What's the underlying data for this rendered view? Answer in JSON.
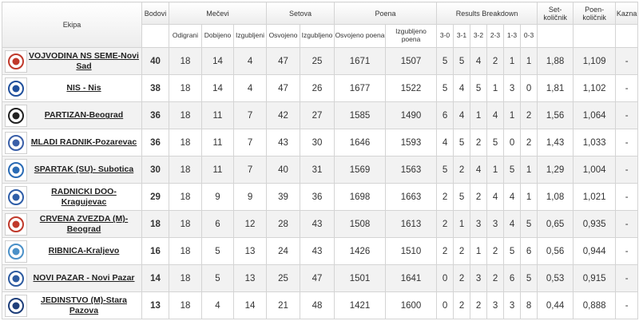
{
  "headers": {
    "team": "Ekipa",
    "points": "Bodovi",
    "matches": "Mečevi",
    "sets": "Setova",
    "points_scored": "Poena",
    "results": "Results Breakdown",
    "set_ratio": "Set-količnik",
    "point_ratio": "Poen-količnik",
    "penalty": "Kazna",
    "played": "Odigrani",
    "won": "Dobijeno",
    "lost": "Izgubljeni",
    "sets_won": "Osvojeno",
    "sets_lost": "Izgubljeno",
    "pts_won": "Osvojeno poena",
    "pts_lost": "Izgubljeno poena",
    "r30": "3-0",
    "r31": "3-1",
    "r32": "3-2",
    "r23": "2-3",
    "r13": "1-3",
    "r03": "0-3"
  },
  "rows": [
    {
      "team": "VOJVODINA NS SEME-Novi Sad",
      "points": "40",
      "played": "18",
      "won": "14",
      "lost": "4",
      "sw": "47",
      "sl": "25",
      "pw": "1671",
      "pl": "1507",
      "r30": "5",
      "r31": "5",
      "r32": "4",
      "r23": "2",
      "r13": "1",
      "r03": "1",
      "sr": "1,88",
      "pr": "1,109",
      "pen": "-",
      "logo": "vojvodina-logo",
      "color": "#c0392b"
    },
    {
      "team": "NIS - Nis",
      "points": "38",
      "played": "18",
      "won": "14",
      "lost": "4",
      "sw": "47",
      "sl": "26",
      "pw": "1677",
      "pl": "1522",
      "r30": "5",
      "r31": "4",
      "r32": "5",
      "r23": "1",
      "r13": "3",
      "r03": "0",
      "sr": "1,81",
      "pr": "1,102",
      "pen": "-",
      "logo": "nis-logo",
      "color": "#1f4f9c"
    },
    {
      "team": "PARTIZAN-Beograd",
      "points": "36",
      "played": "18",
      "won": "11",
      "lost": "7",
      "sw": "42",
      "sl": "27",
      "pw": "1585",
      "pl": "1490",
      "r30": "6",
      "r31": "4",
      "r32": "1",
      "r23": "4",
      "r13": "1",
      "r03": "2",
      "sr": "1,56",
      "pr": "1,064",
      "pen": "-",
      "logo": "partizan-logo",
      "color": "#222222"
    },
    {
      "team": "MLADI RADNIK-Pozarevac",
      "points": "36",
      "played": "18",
      "won": "11",
      "lost": "7",
      "sw": "43",
      "sl": "30",
      "pw": "1646",
      "pl": "1593",
      "r30": "4",
      "r31": "5",
      "r32": "2",
      "r23": "5",
      "r13": "0",
      "r03": "2",
      "sr": "1,43",
      "pr": "1,033",
      "pen": "-",
      "logo": "mladi-radnik-logo",
      "color": "#3a5fa8"
    },
    {
      "team": "SPARTAK (SU)- Subotica",
      "points": "30",
      "played": "18",
      "won": "11",
      "lost": "7",
      "sw": "40",
      "sl": "31",
      "pw": "1569",
      "pl": "1563",
      "r30": "5",
      "r31": "2",
      "r32": "4",
      "r23": "1",
      "r13": "5",
      "r03": "1",
      "sr": "1,29",
      "pr": "1,004",
      "pen": "-",
      "logo": "spartak-logo",
      "color": "#2a6bb5"
    },
    {
      "team": "RADNICKI DOO-Kragujevac",
      "points": "29",
      "played": "18",
      "won": "9",
      "lost": "9",
      "sw": "39",
      "sl": "36",
      "pw": "1698",
      "pl": "1663",
      "r30": "2",
      "r31": "5",
      "r32": "2",
      "r23": "4",
      "r13": "4",
      "r03": "1",
      "sr": "1,08",
      "pr": "1,021",
      "pen": "-",
      "logo": "radnicki-logo",
      "color": "#2f5ea8"
    },
    {
      "team": "CRVENA ZVEZDA (M)-Beograd",
      "points": "18",
      "played": "18",
      "won": "6",
      "lost": "12",
      "sw": "28",
      "sl": "43",
      "pw": "1508",
      "pl": "1613",
      "r30": "2",
      "r31": "1",
      "r32": "3",
      "r23": "3",
      "r13": "4",
      "r03": "5",
      "sr": "0,65",
      "pr": "0,935",
      "pen": "-",
      "logo": "crvena-zvezda-logo",
      "color": "#c0392b"
    },
    {
      "team": "RIBNICA-Kraljevo",
      "points": "16",
      "played": "18",
      "won": "5",
      "lost": "13",
      "sw": "24",
      "sl": "43",
      "pw": "1426",
      "pl": "1510",
      "r30": "2",
      "r31": "2",
      "r32": "1",
      "r23": "2",
      "r13": "5",
      "r03": "6",
      "sr": "0,56",
      "pr": "0,944",
      "pen": "-",
      "logo": "ribnica-logo",
      "color": "#4a90c8"
    },
    {
      "team": "NOVI PAZAR - Novi Pazar",
      "points": "14",
      "played": "18",
      "won": "5",
      "lost": "13",
      "sw": "25",
      "sl": "47",
      "pw": "1501",
      "pl": "1641",
      "r30": "0",
      "r31": "2",
      "r32": "3",
      "r23": "2",
      "r13": "6",
      "r03": "5",
      "sr": "0,53",
      "pr": "0,915",
      "pen": "-",
      "logo": "novi-pazar-logo",
      "color": "#2c5aa0"
    },
    {
      "team": "JEDINSTVO (M)-Stara Pazova",
      "points": "13",
      "played": "18",
      "won": "4",
      "lost": "14",
      "sw": "21",
      "sl": "48",
      "pw": "1421",
      "pl": "1600",
      "r30": "0",
      "r31": "2",
      "r32": "2",
      "r23": "3",
      "r13": "3",
      "r03": "8",
      "sr": "0,44",
      "pr": "0,888",
      "pen": "-",
      "logo": "jedinstvo-logo",
      "color": "#1f3f7a"
    }
  ]
}
